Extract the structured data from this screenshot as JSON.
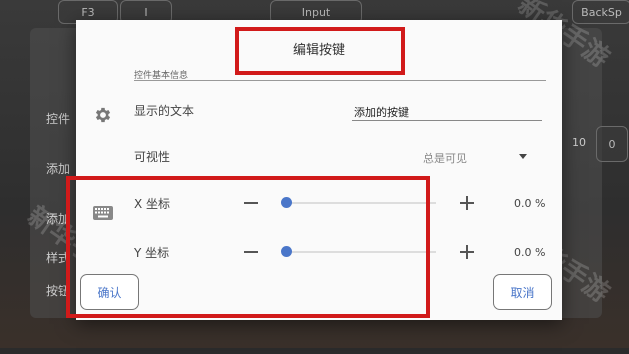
{
  "background": {
    "top_keys": [
      "F3",
      "I",
      "Input",
      "BackSp"
    ],
    "left_rows": [
      "控件",
      "添加",
      "添加",
      "样式",
      "按钮"
    ],
    "right_values": [
      "10",
      "0"
    ],
    "watermark": "新华手游网"
  },
  "dialog": {
    "title": "编辑按键",
    "section_label": "控件基本信息",
    "display_text": {
      "label": "显示的文本",
      "value": "添加的按键"
    },
    "visibility": {
      "label": "可视性",
      "value": "总是可见"
    },
    "x_coord": {
      "label": "X 坐标",
      "value": "0.0 %",
      "level_percent": 0
    },
    "y_coord": {
      "label": "Y 坐标",
      "value": "0.0 %",
      "level_percent": 0
    },
    "confirm_label": "确认",
    "cancel_label": "取消"
  },
  "colors": {
    "accent": "#4a76c9",
    "highlight": "#d11a1a"
  }
}
